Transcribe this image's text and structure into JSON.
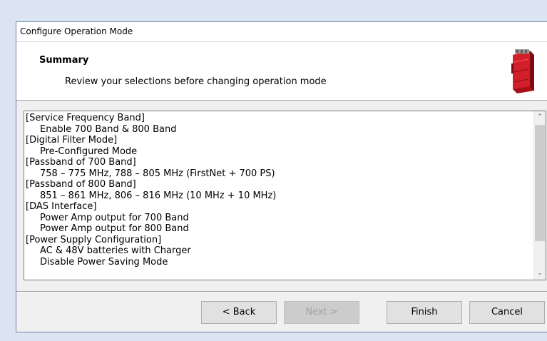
{
  "window": {
    "title": "Configure Operation Mode"
  },
  "header": {
    "title": "Summary",
    "subtitle": "Review your selections before changing operation mode",
    "product_icon": "red-booster-device-icon"
  },
  "summary": {
    "lines": [
      {
        "text": "[Service Frequency Band]",
        "indent": false
      },
      {
        "text": "Enable 700 Band & 800 Band",
        "indent": true
      },
      {
        "text": "[Digital Filter Mode]",
        "indent": false
      },
      {
        "text": "Pre-Configured Mode",
        "indent": true
      },
      {
        "text": "[Passband of 700 Band]",
        "indent": false
      },
      {
        "text": "758 – 775 MHz, 788 – 805 MHz (FirstNet + 700 PS)",
        "indent": true
      },
      {
        "text": "[Passband of 800 Band]",
        "indent": false
      },
      {
        "text": "851 – 861 MHz, 806 – 816 MHz (10 MHz + 10 MHz)",
        "indent": true
      },
      {
        "text": "[DAS Interface]",
        "indent": false
      },
      {
        "text": "Power Amp output for 700 Band",
        "indent": true
      },
      {
        "text": "Power Amp output for 800 Band",
        "indent": true
      },
      {
        "text": "[Power Supply Configuration]",
        "indent": false
      },
      {
        "text": "AC & 48V batteries with Charger",
        "indent": true
      },
      {
        "text": "Disable Power Saving Mode",
        "indent": true
      }
    ],
    "scroll_up_icon": "chevron-up-icon",
    "scroll_down_icon": "chevron-down-icon"
  },
  "buttons": {
    "back": "< Back",
    "next": "Next >",
    "finish": "Finish",
    "cancel": "Cancel",
    "next_enabled": false
  },
  "colors": {
    "device_red": "#c8141e",
    "window_border": "#6f86a8"
  }
}
